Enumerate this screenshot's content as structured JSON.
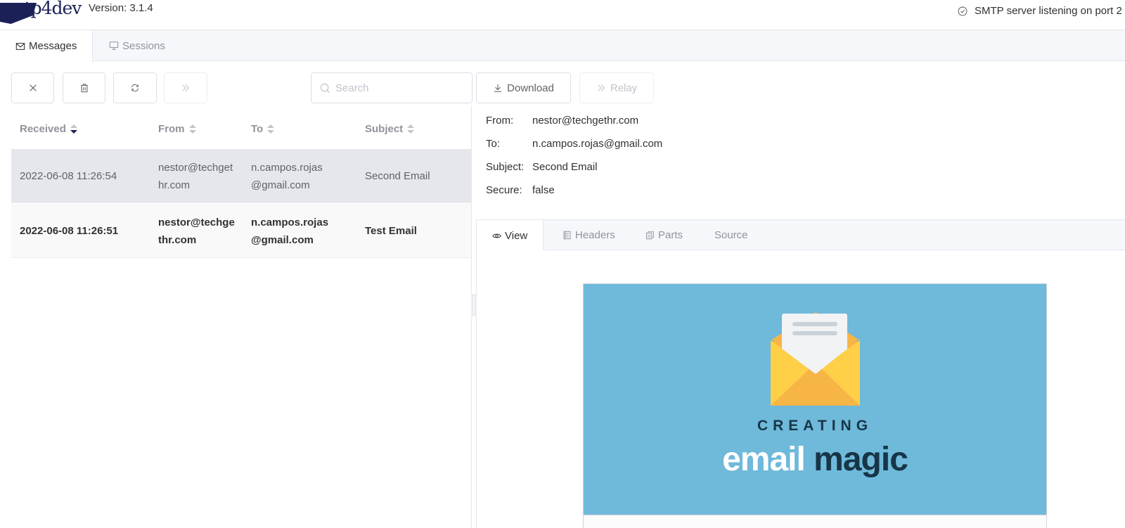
{
  "app": {
    "logo_text": "smtp4dev",
    "version": "Version: 3.1.4",
    "status": "SMTP server listening on port 2"
  },
  "main_tabs": [
    {
      "label": "Messages",
      "icon": "envelope-icon",
      "active": true
    },
    {
      "label": "Sessions",
      "icon": "monitor-icon",
      "active": false
    }
  ],
  "toolbar": {
    "clear_icon": "close-icon",
    "delete_icon": "trash-icon",
    "refresh_icon": "refresh-icon",
    "relay_icon": "double-chevron-right-icon",
    "search_placeholder": "Search",
    "search_value": "",
    "download_label": "Download",
    "relay_label": "Relay"
  },
  "table": {
    "columns": [
      {
        "label": "Received",
        "sort": "desc"
      },
      {
        "label": "From",
        "sort": "none"
      },
      {
        "label": "To",
        "sort": "none"
      },
      {
        "label": "Subject",
        "sort": "none"
      }
    ],
    "rows": [
      {
        "received": "2022-06-08 11:26:54",
        "from_1": "nestor@techget",
        "from_2": "hr.com",
        "to_1": "n.campos.rojas",
        "to_2": "@gmail.com",
        "subject": "Second Email",
        "selected": true,
        "unread": false
      },
      {
        "received": "2022-06-08 11:26:51",
        "from_1": "nestor@techge",
        "from_2": "thr.com",
        "to_1": "n.campos.rojas",
        "to_2": "@gmail.com",
        "subject": "Test Email",
        "selected": false,
        "unread": true
      }
    ]
  },
  "message": {
    "headers": [
      {
        "key": "From:",
        "value": "nestor@techgethr.com"
      },
      {
        "key": "To:",
        "value": "n.campos.rojas@gmail.com"
      },
      {
        "key": "Subject:",
        "value": "Second Email"
      },
      {
        "key": "Secure:",
        "value": "false"
      }
    ],
    "tabs": [
      {
        "label": "View",
        "icon": "eye-icon",
        "active": true
      },
      {
        "label": "Headers",
        "icon": "document-icon",
        "active": false
      },
      {
        "label": "Parts",
        "icon": "copy-document-icon",
        "active": false
      },
      {
        "label": "Source",
        "icon": "",
        "active": false
      }
    ],
    "body": {
      "banner_line1": "CREATING",
      "banner_word1": "email",
      "banner_word2": "magic",
      "banner_color": "#6fb9da"
    }
  }
}
